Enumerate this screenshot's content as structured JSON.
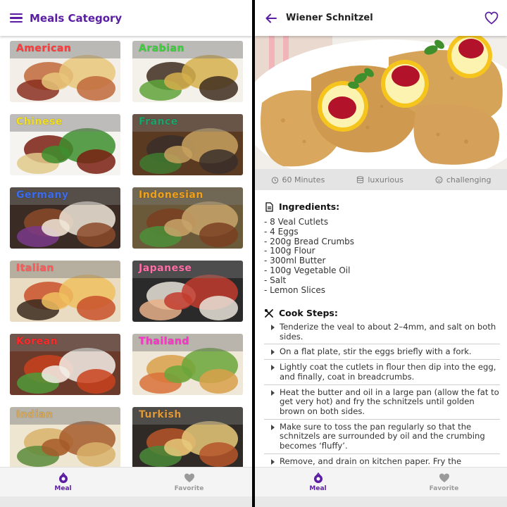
{
  "left": {
    "title": "Meals Category",
    "categories": [
      {
        "label": "American",
        "color": "#ff3b3b"
      },
      {
        "label": "Arabian",
        "color": "#3ad13a"
      },
      {
        "label": "Chinese",
        "color": "#f5e01a"
      },
      {
        "label": "France",
        "color": "#1fa36a"
      },
      {
        "label": "Germany",
        "color": "#3b6df0"
      },
      {
        "label": "Indonesian",
        "color": "#f2a21a"
      },
      {
        "label": "Italian",
        "color": "#ff5a5a"
      },
      {
        "label": "Japanese",
        "color": "#ff6fa8"
      },
      {
        "label": "Korean",
        "color": "#ff2a2a"
      },
      {
        "label": "Thailand",
        "color": "#ff33cc"
      },
      {
        "label": "Indian",
        "color": "#d8a95a"
      },
      {
        "label": "Turkish",
        "color": "#e09a3a"
      }
    ]
  },
  "right": {
    "title": "Wiener Schnitzel",
    "meta": {
      "duration": "60 Minutes",
      "affordability": "luxurious",
      "complexity": "challenging"
    },
    "ingredients_title": "Ingredients:",
    "ingredients": [
      "- 8 Veal Cutlets",
      "- 4 Eggs",
      "- 200g Bread Crumbs",
      "- 100g Flour",
      "- 300ml Butter",
      "- 100g Vegetable Oil",
      "- Salt",
      "- Lemon Slices"
    ],
    "steps_title": "Cook Steps:",
    "steps": [
      "Tenderize the veal to about 2–4mm, and salt on both sides.",
      "On a flat plate, stir the eggs briefly with a fork.",
      "Lightly coat the cutlets in flour then dip into the egg, and finally, coat in breadcrumbs.",
      "Heat the butter and oil in a large pan (allow the fat to get very hot) and fry the schnitzels until golden brown on both sides.",
      "Make sure to toss the pan regularly so that the schnitzels are surrounded by oil and the crumbing becomes ‘fluffy’.",
      "Remove, and drain on kitchen paper. Fry the"
    ]
  },
  "nav": {
    "meal_label": "Meal",
    "favorite_label": "Favorite"
  },
  "colors": {
    "accent": "#5b1ea3",
    "inactive": "#9a9a9a"
  }
}
